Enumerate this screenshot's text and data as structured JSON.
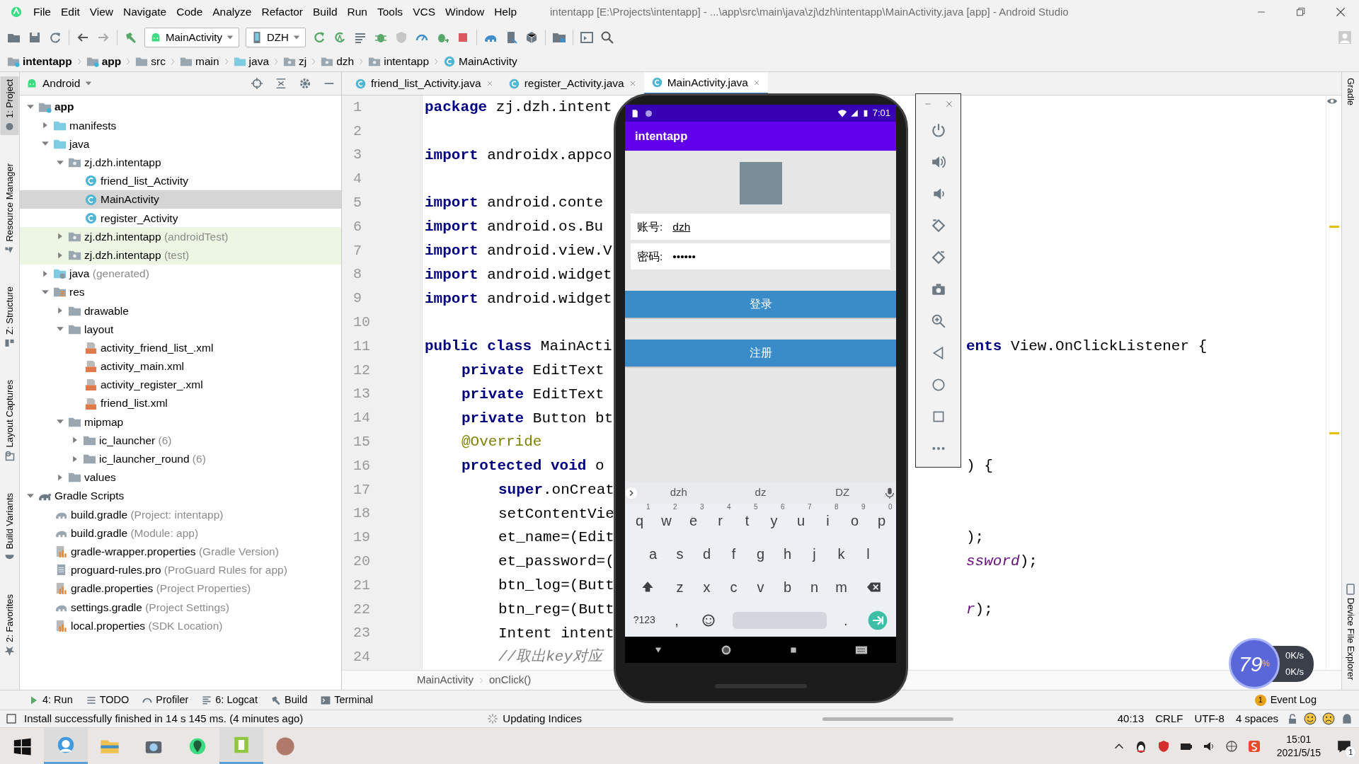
{
  "window": {
    "title": "intentapp [E:\\Projects\\intentapp] - ...\\app\\src\\main\\java\\zj\\dzh\\intentapp\\MainActivity.java [app] - Android Studio"
  },
  "menu": [
    "File",
    "Edit",
    "View",
    "Navigate",
    "Code",
    "Analyze",
    "Refactor",
    "Build",
    "Run",
    "Tools",
    "VCS",
    "Window",
    "Help"
  ],
  "toolbar": {
    "run_config": "MainActivity",
    "device": "DZH"
  },
  "breadcrumbs": [
    {
      "label": "intentapp",
      "kind": "module"
    },
    {
      "label": "app",
      "kind": "module"
    },
    {
      "label": "src",
      "kind": "folder"
    },
    {
      "label": "main",
      "kind": "folder"
    },
    {
      "label": "java",
      "kind": "source"
    },
    {
      "label": "zj",
      "kind": "package"
    },
    {
      "label": "dzh",
      "kind": "package"
    },
    {
      "label": "intentapp",
      "kind": "package"
    },
    {
      "label": "MainActivity",
      "kind": "class"
    }
  ],
  "left_tabs": [
    {
      "label": "1: Project",
      "selected": true
    },
    {
      "label": "Resource Manager",
      "selected": false
    },
    {
      "label": "Z: Structure",
      "selected": false
    },
    {
      "label": "Layout Captures",
      "selected": false
    },
    {
      "label": "Build Variants",
      "selected": false
    },
    {
      "label": "2: Favorites",
      "selected": false
    }
  ],
  "right_tabs": [
    "Gradle",
    "Device File Explorer"
  ],
  "project_panel": {
    "view": "Android",
    "tree": [
      {
        "name": "app",
        "kind": "module",
        "expanded": true,
        "selected": false,
        "children": [
          {
            "name": "manifests",
            "kind": "source-folder",
            "expanded": false,
            "selected": false
          },
          {
            "name": "java",
            "kind": "source-folder",
            "expanded": true,
            "selected": false,
            "children": [
              {
                "name": "zj.dzh.intentapp",
                "kind": "package",
                "expanded": true,
                "selected": false,
                "children": [
                  {
                    "name": "friend_list_Activity",
                    "kind": "class",
                    "selected": false
                  },
                  {
                    "name": "MainActivity",
                    "kind": "class",
                    "selected": true
                  },
                  {
                    "name": "register_Activity",
                    "kind": "class",
                    "selected": false
                  }
                ]
              },
              {
                "name": "zj.dzh.intentapp",
                "hint": "(androidTest)",
                "kind": "test-package",
                "expanded": false,
                "selected": false
              },
              {
                "name": "zj.dzh.intentapp",
                "hint": "(test)",
                "kind": "test-package",
                "expanded": false,
                "selected": false
              }
            ]
          },
          {
            "name": "java",
            "hint": "(generated)",
            "kind": "generated-folder",
            "expanded": false,
            "selected": false
          },
          {
            "name": "res",
            "kind": "res-folder",
            "expanded": true,
            "selected": false,
            "children": [
              {
                "name": "drawable",
                "kind": "folder",
                "expanded": false,
                "selected": false
              },
              {
                "name": "layout",
                "kind": "folder",
                "expanded": true,
                "selected": false,
                "children": [
                  {
                    "name": "activity_friend_list_.xml",
                    "kind": "xml",
                    "selected": false
                  },
                  {
                    "name": "activity_main.xml",
                    "kind": "xml",
                    "selected": false
                  },
                  {
                    "name": "activity_register_.xml",
                    "kind": "xml",
                    "selected": false
                  },
                  {
                    "name": "friend_list.xml",
                    "kind": "xml",
                    "selected": false
                  }
                ]
              },
              {
                "name": "mipmap",
                "kind": "folder",
                "expanded": true,
                "selected": false,
                "children": [
                  {
                    "name": "ic_launcher",
                    "hint": "(6)",
                    "kind": "folder",
                    "expanded": false,
                    "selected": false
                  },
                  {
                    "name": "ic_launcher_round",
                    "hint": "(6)",
                    "kind": "folder",
                    "expanded": false,
                    "selected": false
                  }
                ]
              },
              {
                "name": "values",
                "kind": "folder",
                "expanded": false,
                "selected": false
              }
            ]
          }
        ]
      },
      {
        "name": "Gradle Scripts",
        "kind": "gradle-root",
        "expanded": true,
        "selected": false,
        "children": [
          {
            "name": "build.gradle",
            "hint": "(Project: intentapp)",
            "kind": "gradle",
            "selected": false
          },
          {
            "name": "build.gradle",
            "hint": "(Module: app)",
            "kind": "gradle",
            "selected": false
          },
          {
            "name": "gradle-wrapper.properties",
            "hint": "(Gradle Version)",
            "kind": "properties",
            "selected": false
          },
          {
            "name": "proguard-rules.pro",
            "hint": "(ProGuard Rules for app)",
            "kind": "text-file",
            "selected": false
          },
          {
            "name": "gradle.properties",
            "hint": "(Project Properties)",
            "kind": "properties",
            "selected": false
          },
          {
            "name": "settings.gradle",
            "hint": "(Project Settings)",
            "kind": "gradle",
            "selected": false
          },
          {
            "name": "local.properties",
            "hint": "(SDK Location)",
            "kind": "properties",
            "selected": false
          }
        ]
      }
    ]
  },
  "editor": {
    "tabs": [
      {
        "label": "friend_list_Activity.java",
        "selected": false
      },
      {
        "label": "register_Activity.java",
        "selected": false
      },
      {
        "label": "MainActivity.java",
        "selected": true
      }
    ],
    "lines": [
      {
        "num": "1",
        "text": "**package** zj.dzh.intent"
      },
      {
        "num": "2"
      },
      {
        "num": "3",
        "text": "**import** androidx.appco"
      },
      {
        "num": "4"
      },
      {
        "num": "5",
        "text": "**import** android.conte"
      },
      {
        "num": "6",
        "text": "**import** android.os.Bu"
      },
      {
        "num": "7",
        "text": "**import** android.view.V"
      },
      {
        "num": "8",
        "text": "**import** android.widget"
      },
      {
        "num": "9",
        "text": "**import** android.widget"
      },
      {
        "num": "10"
      },
      {
        "num": "11",
        "text": "**public class** MainActi",
        "right": "**ents** View.OnClickListener {",
        "children": [
          {
            "num": "12",
            "text": "**private** EditText"
          },
          {
            "num": "13",
            "text": "**private** EditText"
          },
          {
            "num": "14",
            "text": "**private** Button bt"
          },
          {
            "num": "15",
            "text": "@Override",
            "kind": "annotation"
          },
          {
            "num": "16",
            "text": "**protected void** o",
            "right": ") {",
            "children": [
              {
                "num": "17",
                "text": "**super**.onCreat"
              },
              {
                "num": "18",
                "text": "setContentVie"
              },
              {
                "num": "19",
                "text": "et_name=(Edit",
                "right": ");"
              },
              {
                "num": "20",
                "text": "et_password=(",
                "right": "*ssword*);"
              },
              {
                "num": "21",
                "text": "btn_log=(Butt"
              },
              {
                "num": "22",
                "text": "btn_reg=(Butt",
                "right": "*r*);"
              },
              {
                "num": "23",
                "text": "Intent intent"
              },
              {
                "num": "24",
                "text": "//取出key对应",
                "kind": "comment"
              }
            ]
          }
        ]
      }
    ],
    "breadcrumb": [
      "MainActivity",
      "onClick()"
    ]
  },
  "emulator": {
    "time": "7:01",
    "app_title": "intentapp",
    "fields": [
      {
        "label": "账号:",
        "value": "dzh",
        "composing": true
      },
      {
        "label": "密码:",
        "value": "••••••",
        "composing": false
      }
    ],
    "buttons": [
      "登录",
      "注册"
    ],
    "keyboard": {
      "suggestions": [
        "dzh",
        "dz",
        "DZ"
      ],
      "rows": [
        [
          {
            "kind": "letter",
            "label": "q",
            "hint": "1"
          },
          {
            "kind": "letter",
            "label": "w",
            "hint": "2"
          },
          {
            "kind": "letter",
            "label": "e",
            "hint": "3"
          },
          {
            "kind": "letter",
            "label": "r",
            "hint": "4"
          },
          {
            "kind": "letter",
            "label": "t",
            "hint": "5"
          },
          {
            "kind": "letter",
            "label": "y",
            "hint": "6"
          },
          {
            "kind": "letter",
            "label": "u",
            "hint": "7"
          },
          {
            "kind": "letter",
            "label": "i",
            "hint": "8"
          },
          {
            "kind": "letter",
            "label": "o",
            "hint": "9"
          },
          {
            "kind": "letter",
            "label": "p",
            "hint": "0"
          }
        ],
        [
          {
            "kind": "letter",
            "label": "a"
          },
          {
            "kind": "letter",
            "label": "s"
          },
          {
            "kind": "letter",
            "label": "d"
          },
          {
            "kind": "letter",
            "label": "f"
          },
          {
            "kind": "letter",
            "label": "g"
          },
          {
            "kind": "letter",
            "label": "h"
          },
          {
            "kind": "letter",
            "label": "j"
          },
          {
            "kind": "letter",
            "label": "k"
          },
          {
            "kind": "letter",
            "label": "l"
          }
        ],
        [
          {
            "kind": "shift"
          },
          {
            "kind": "letter",
            "label": "z"
          },
          {
            "kind": "letter",
            "label": "x"
          },
          {
            "kind": "letter",
            "label": "c"
          },
          {
            "kind": "letter",
            "label": "v"
          },
          {
            "kind": "letter",
            "label": "b"
          },
          {
            "kind": "letter",
            "label": "n"
          },
          {
            "kind": "letter",
            "label": "m"
          },
          {
            "kind": "backspace"
          }
        ],
        [
          {
            "kind": "symbols",
            "label": "?123"
          },
          {
            "kind": "letter",
            "label": ","
          },
          {
            "kind": "emoji"
          },
          {
            "kind": "space"
          },
          {
            "kind": "letter",
            "label": "."
          },
          {
            "kind": "enter"
          }
        ]
      ]
    }
  },
  "bottom_tabs": [
    "4: Run",
    "TODO",
    "Profiler",
    "6: Logcat",
    "Build",
    "Terminal"
  ],
  "event_log": {
    "label": "Event Log",
    "count": "1"
  },
  "status_bar": {
    "message": "Install successfully finished in 14 s 145 ms. (4 minutes ago)",
    "task": "Updating Indices",
    "level": 1,
    "items": [
      "40:13",
      "CRLF",
      "UTF-8",
      "4 spaces"
    ]
  },
  "speed_widget": {
    "percent": "79",
    "unit": "%",
    "upload": "0K/s",
    "download": "0K/s"
  },
  "taskbar": {
    "time": "15:01",
    "date": "2021/5/15",
    "notifications": "1"
  }
}
